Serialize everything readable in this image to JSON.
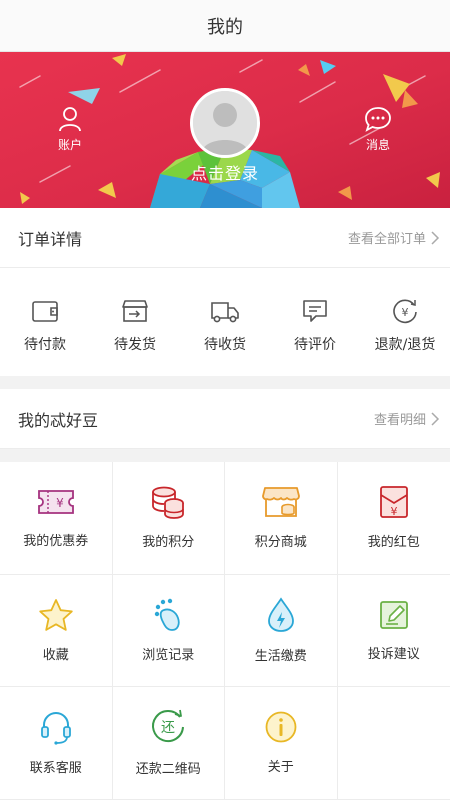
{
  "header": {
    "title": "我的"
  },
  "hero": {
    "account_label": "账户",
    "messages_label": "消息",
    "login_label": "点击登录"
  },
  "orders": {
    "title": "订单详情",
    "view_all": "查看全部订单",
    "items": [
      {
        "label": "待付款",
        "icon": "wallet-icon"
      },
      {
        "label": "待发货",
        "icon": "package-ship-icon"
      },
      {
        "label": "待收货",
        "icon": "truck-icon"
      },
      {
        "label": "待评价",
        "icon": "comment-icon"
      },
      {
        "label": "退款/退货",
        "icon": "refund-icon"
      }
    ]
  },
  "beans": {
    "title": "我的忒好豆",
    "view_detail": "查看明细"
  },
  "grid": {
    "items": [
      {
        "label": "我的优惠券",
        "icon": "coupon-icon",
        "color": "#a5327f"
      },
      {
        "label": "我的积分",
        "icon": "points-coins-icon",
        "color": "#c8262b"
      },
      {
        "label": "积分商城",
        "icon": "points-store-icon",
        "color": "#e79a2b"
      },
      {
        "label": "我的红包",
        "icon": "red-envelope-icon",
        "color": "#c8262b"
      },
      {
        "label": "收藏",
        "icon": "star-icon",
        "color": "#e8b725"
      },
      {
        "label": "浏览记录",
        "icon": "footprint-icon",
        "color": "#2aa7d6"
      },
      {
        "label": "生活缴费",
        "icon": "water-drop-icon",
        "color": "#2aa7d6"
      },
      {
        "label": "投诉建议",
        "icon": "edit-icon",
        "color": "#6bb146"
      },
      {
        "label": "联系客服",
        "icon": "headset-icon",
        "color": "#2aa7d6"
      },
      {
        "label": "还款二维码",
        "icon": "repay-icon",
        "color": "#3a9a4a"
      },
      {
        "label": "关于",
        "icon": "info-icon",
        "color": "#e8b725"
      }
    ]
  },
  "colors": {
    "hero_red": "#dc2c49",
    "text": "#333333",
    "muted": "#999999"
  }
}
